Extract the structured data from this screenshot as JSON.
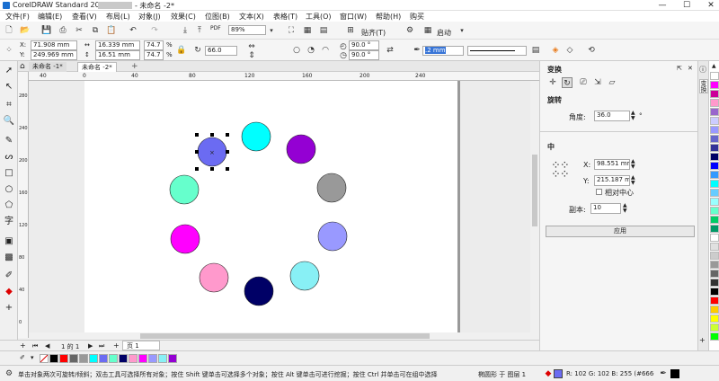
{
  "titlebar": {
    "app_title": "CorelDRAW Standard 2021 (64-Bi",
    "doc_title": "- 未命名 -2*",
    "minimize": "—",
    "maximize": "☐",
    "close": "✕"
  },
  "menubar": {
    "items": [
      "文件(F)",
      "编辑(E)",
      "查看(V)",
      "布局(L)",
      "对象(J)",
      "效果(C)",
      "位图(B)",
      "文本(X)",
      "表格(T)",
      "工具(O)",
      "窗口(W)",
      "帮助(H)",
      "购买"
    ]
  },
  "toolbar": {
    "zoom": "89%",
    "snap_label": "贴齐(T)",
    "launch_label": "启动",
    "pdf_label": "PDF"
  },
  "propbar": {
    "x_label": "X:",
    "x_value": "71.908 mm",
    "y_label": "Y:",
    "y_value": "249.969 mm",
    "width_value": "16.339 mm",
    "height_value": "16.51 mm",
    "scale_w": "74.7",
    "scale_h": "74.7",
    "pct": "%",
    "rotation": "66.0",
    "arc_start": "90.0 °",
    "arc_end": "90.0 °",
    "outline_width": ".2 mm"
  },
  "doctabs": {
    "tabs": [
      "未命名 -1*",
      "未命名 -2*"
    ],
    "add": "+"
  },
  "ruler": {
    "h_ticks": [
      "40",
      "0",
      "40",
      "80",
      "120",
      "160",
      "200",
      "240"
    ],
    "v_ticks": [
      "280",
      "240",
      "200",
      "160",
      "120",
      "80",
      "40",
      "0"
    ]
  },
  "canvas": {
    "circles": [
      {
        "color": "#6b6bf2",
        "selected": true
      },
      {
        "color": "#00ffff",
        "selected": false
      },
      {
        "color": "#9400d3",
        "selected": false
      },
      {
        "color": "#999999",
        "selected": false
      },
      {
        "color": "#9999ff",
        "selected": false
      },
      {
        "color": "#88f0f5",
        "selected": false
      },
      {
        "color": "#000066",
        "selected": false
      },
      {
        "color": "#ff99cc",
        "selected": false
      },
      {
        "color": "#ff00ff",
        "selected": false
      },
      {
        "color": "#66ffcc",
        "selected": false
      }
    ]
  },
  "pagebar": {
    "page_count": "1 的 1",
    "page_tab": "页 1"
  },
  "docker": {
    "title": "变换",
    "section_rotate": "旋转",
    "angle_label": "角度:",
    "angle_value": "36.0",
    "angle_unit": "°",
    "section_center": "中",
    "x_label": "X:",
    "x_value": "98.551 mm",
    "y_label": "Y:",
    "y_value": "215.187 mm",
    "relative_center": "相对中心",
    "copies_label": "副本:",
    "copies_value": "10",
    "apply_button": "应用",
    "side_tab": "变换"
  },
  "palette": {
    "bottom": [
      "#ffffff",
      "#000000",
      "#ff0000",
      "#666666",
      "#999999",
      "#00ffff",
      "#6b6bf2",
      "#66ffcc",
      "#000066",
      "#ff99cc",
      "#ff00ff",
      "#9999ff",
      "#88f0f5",
      "#9400d3"
    ],
    "right": [
      "#ffffff",
      "#ff00ff",
      "#cc0099",
      "#ff99cc",
      "#9966cc",
      "#ccccff",
      "#9999ff",
      "#6666cc",
      "#333399",
      "#000066",
      "#0000ff",
      "#3399ff",
      "#00ffff",
      "#66ccff",
      "#99ffff",
      "#66ffcc",
      "#00cc66",
      "#009966",
      "#ffffff",
      "#e0e0e0",
      "#cccccc",
      "#999999",
      "#666666",
      "#333333",
      "#000000",
      "#ff0000",
      "#ffcc00",
      "#ffff00",
      "#ccff33",
      "#00ff00"
    ]
  },
  "statusbar": {
    "hint": "单击对象两次可旋转/倾斜；双击工具可选择所有对象；按住 Shift 键单击可选择多个对象；按住 Alt 键单击可进行挖掘；按住 Ctrl 并单击可在组中选择",
    "object_info": "椭圆形 于 图层 1",
    "rgb": "R: 102 G: 102 B: 255 (#6666FF)"
  }
}
